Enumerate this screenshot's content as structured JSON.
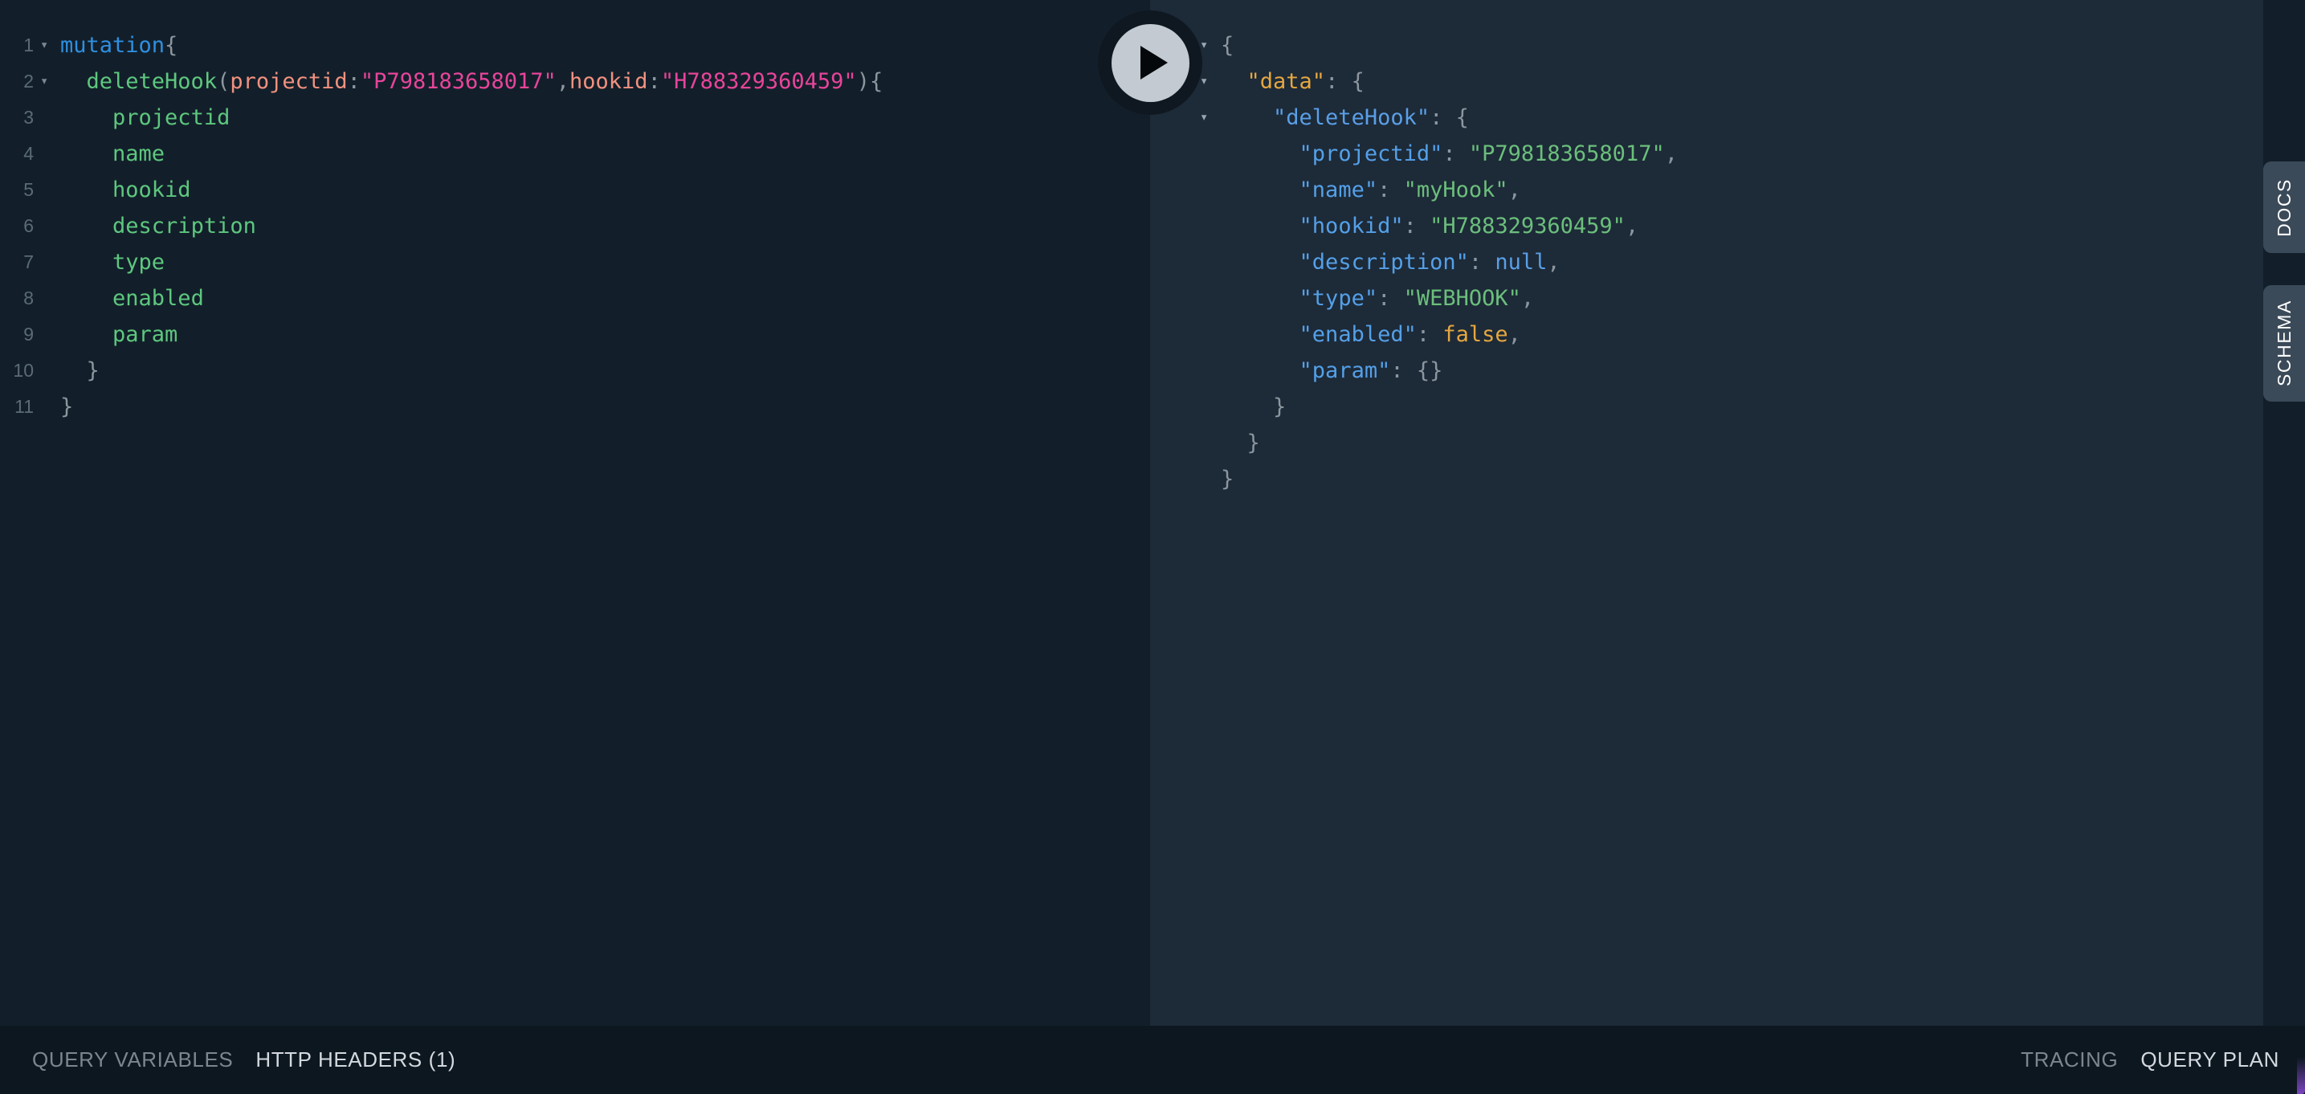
{
  "app": {
    "name": "GraphQL Playground",
    "background": "#0d1720",
    "editor_background": "#121f2a",
    "result_background": "#1d2a38",
    "rail_background": "#121f2a",
    "tab_background": "#3b4a59",
    "accent": "#7a46be"
  },
  "execute_button": {
    "name": "execute-query-button",
    "icon": "play-icon",
    "circle_color": "#c3cad1",
    "ring_color": "#0f1821",
    "glyph_color": "#05080b"
  },
  "editor": {
    "title": "Query Editor",
    "lines": [
      {
        "number": "1",
        "fold": "▾",
        "tokens": [
          {
            "text": "mutation",
            "cls": "q-kw"
          },
          {
            "text": "{",
            "cls": "q-punc"
          }
        ]
      },
      {
        "number": "2",
        "fold": "▾",
        "tokens": [
          {
            "text": "  ",
            "cls": "q-punc"
          },
          {
            "text": "deleteHook",
            "cls": "q-field"
          },
          {
            "text": "(",
            "cls": "q-punc"
          },
          {
            "text": "projectid",
            "cls": "q-arg"
          },
          {
            "text": ":",
            "cls": "q-punc"
          },
          {
            "text": "\"P798183658017\"",
            "cls": "q-str"
          },
          {
            "text": ",",
            "cls": "q-punc"
          },
          {
            "text": "hookid",
            "cls": "q-arg"
          },
          {
            "text": ":",
            "cls": "q-punc"
          },
          {
            "text": "\"H788329360459\"",
            "cls": "q-str"
          },
          {
            "text": ")",
            "cls": "q-punc"
          },
          {
            "text": "{",
            "cls": "q-punc"
          }
        ]
      },
      {
        "number": "3",
        "fold": "",
        "tokens": [
          {
            "text": "    ",
            "cls": "q-punc"
          },
          {
            "text": "projectid",
            "cls": "q-field"
          }
        ]
      },
      {
        "number": "4",
        "fold": "",
        "tokens": [
          {
            "text": "    ",
            "cls": "q-punc"
          },
          {
            "text": "name",
            "cls": "q-field"
          }
        ]
      },
      {
        "number": "5",
        "fold": "",
        "tokens": [
          {
            "text": "    ",
            "cls": "q-punc"
          },
          {
            "text": "hookid",
            "cls": "q-field"
          }
        ]
      },
      {
        "number": "6",
        "fold": "",
        "tokens": [
          {
            "text": "    ",
            "cls": "q-punc"
          },
          {
            "text": "description",
            "cls": "q-field"
          }
        ]
      },
      {
        "number": "7",
        "fold": "",
        "tokens": [
          {
            "text": "    ",
            "cls": "q-punc"
          },
          {
            "text": "type",
            "cls": "q-field"
          }
        ]
      },
      {
        "number": "8",
        "fold": "",
        "tokens": [
          {
            "text": "    ",
            "cls": "q-punc"
          },
          {
            "text": "enabled",
            "cls": "q-field"
          }
        ]
      },
      {
        "number": "9",
        "fold": "",
        "tokens": [
          {
            "text": "    ",
            "cls": "q-punc"
          },
          {
            "text": "param",
            "cls": "q-field"
          }
        ]
      },
      {
        "number": "10",
        "fold": "",
        "tokens": [
          {
            "text": "  ",
            "cls": "q-punc"
          },
          {
            "text": "}",
            "cls": "q-punc"
          }
        ]
      },
      {
        "number": "11",
        "fold": "",
        "tokens": [
          {
            "text": "}",
            "cls": "q-punc"
          }
        ]
      }
    ]
  },
  "result": {
    "title": "Response Viewer",
    "lines": [
      {
        "fold": "▾",
        "tokens": [
          {
            "text": "{",
            "cls": "r-punc"
          }
        ]
      },
      {
        "fold": "▾",
        "tokens": [
          {
            "text": "  ",
            "cls": "r-punc"
          },
          {
            "text": "\"data\"",
            "cls": "r-key-top"
          },
          {
            "text": ": {",
            "cls": "r-punc"
          }
        ]
      },
      {
        "fold": "▾",
        "tokens": [
          {
            "text": "    ",
            "cls": "r-punc"
          },
          {
            "text": "\"deleteHook\"",
            "cls": "r-key-op"
          },
          {
            "text": ": {",
            "cls": "r-punc"
          }
        ]
      },
      {
        "fold": "",
        "tokens": [
          {
            "text": "      ",
            "cls": "r-punc"
          },
          {
            "text": "\"projectid\"",
            "cls": "r-key"
          },
          {
            "text": ": ",
            "cls": "r-punc"
          },
          {
            "text": "\"P798183658017\"",
            "cls": "r-str"
          },
          {
            "text": ",",
            "cls": "r-punc"
          }
        ]
      },
      {
        "fold": "",
        "tokens": [
          {
            "text": "      ",
            "cls": "r-punc"
          },
          {
            "text": "\"name\"",
            "cls": "r-key"
          },
          {
            "text": ": ",
            "cls": "r-punc"
          },
          {
            "text": "\"myHook\"",
            "cls": "r-str"
          },
          {
            "text": ",",
            "cls": "r-punc"
          }
        ]
      },
      {
        "fold": "",
        "tokens": [
          {
            "text": "      ",
            "cls": "r-punc"
          },
          {
            "text": "\"hookid\"",
            "cls": "r-key"
          },
          {
            "text": ": ",
            "cls": "r-punc"
          },
          {
            "text": "\"H788329360459\"",
            "cls": "r-str"
          },
          {
            "text": ",",
            "cls": "r-punc"
          }
        ]
      },
      {
        "fold": "",
        "tokens": [
          {
            "text": "      ",
            "cls": "r-punc"
          },
          {
            "text": "\"description\"",
            "cls": "r-key"
          },
          {
            "text": ": ",
            "cls": "r-punc"
          },
          {
            "text": "null",
            "cls": "r-null"
          },
          {
            "text": ",",
            "cls": "r-punc"
          }
        ]
      },
      {
        "fold": "",
        "tokens": [
          {
            "text": "      ",
            "cls": "r-punc"
          },
          {
            "text": "\"type\"",
            "cls": "r-key"
          },
          {
            "text": ": ",
            "cls": "r-punc"
          },
          {
            "text": "\"WEBHOOK\"",
            "cls": "r-str"
          },
          {
            "text": ",",
            "cls": "r-punc"
          }
        ]
      },
      {
        "fold": "",
        "tokens": [
          {
            "text": "      ",
            "cls": "r-punc"
          },
          {
            "text": "\"enabled\"",
            "cls": "r-key"
          },
          {
            "text": ": ",
            "cls": "r-punc"
          },
          {
            "text": "false",
            "cls": "r-bool"
          },
          {
            "text": ",",
            "cls": "r-punc"
          }
        ]
      },
      {
        "fold": "",
        "tokens": [
          {
            "text": "      ",
            "cls": "r-punc"
          },
          {
            "text": "\"param\"",
            "cls": "r-key"
          },
          {
            "text": ": ",
            "cls": "r-punc"
          },
          {
            "text": "{}",
            "cls": "r-punc"
          }
        ]
      },
      {
        "fold": "",
        "tokens": [
          {
            "text": "    }",
            "cls": "r-punc"
          }
        ]
      },
      {
        "fold": "",
        "tokens": [
          {
            "text": "  }",
            "cls": "r-punc"
          }
        ]
      },
      {
        "fold": "",
        "tokens": [
          {
            "text": "}",
            "cls": "r-punc"
          }
        ]
      }
    ]
  },
  "right_rail": {
    "docs_label": "DOCS",
    "schema_label": "SCHEMA"
  },
  "bottom_bar": {
    "left_tabs": [
      {
        "label": "QUERY VARIABLES",
        "active": false
      },
      {
        "label": "HTTP HEADERS (1)",
        "active": true
      }
    ],
    "right_tabs": [
      {
        "label": "TRACING",
        "active": false
      },
      {
        "label": "QUERY PLAN",
        "active": true
      }
    ]
  }
}
